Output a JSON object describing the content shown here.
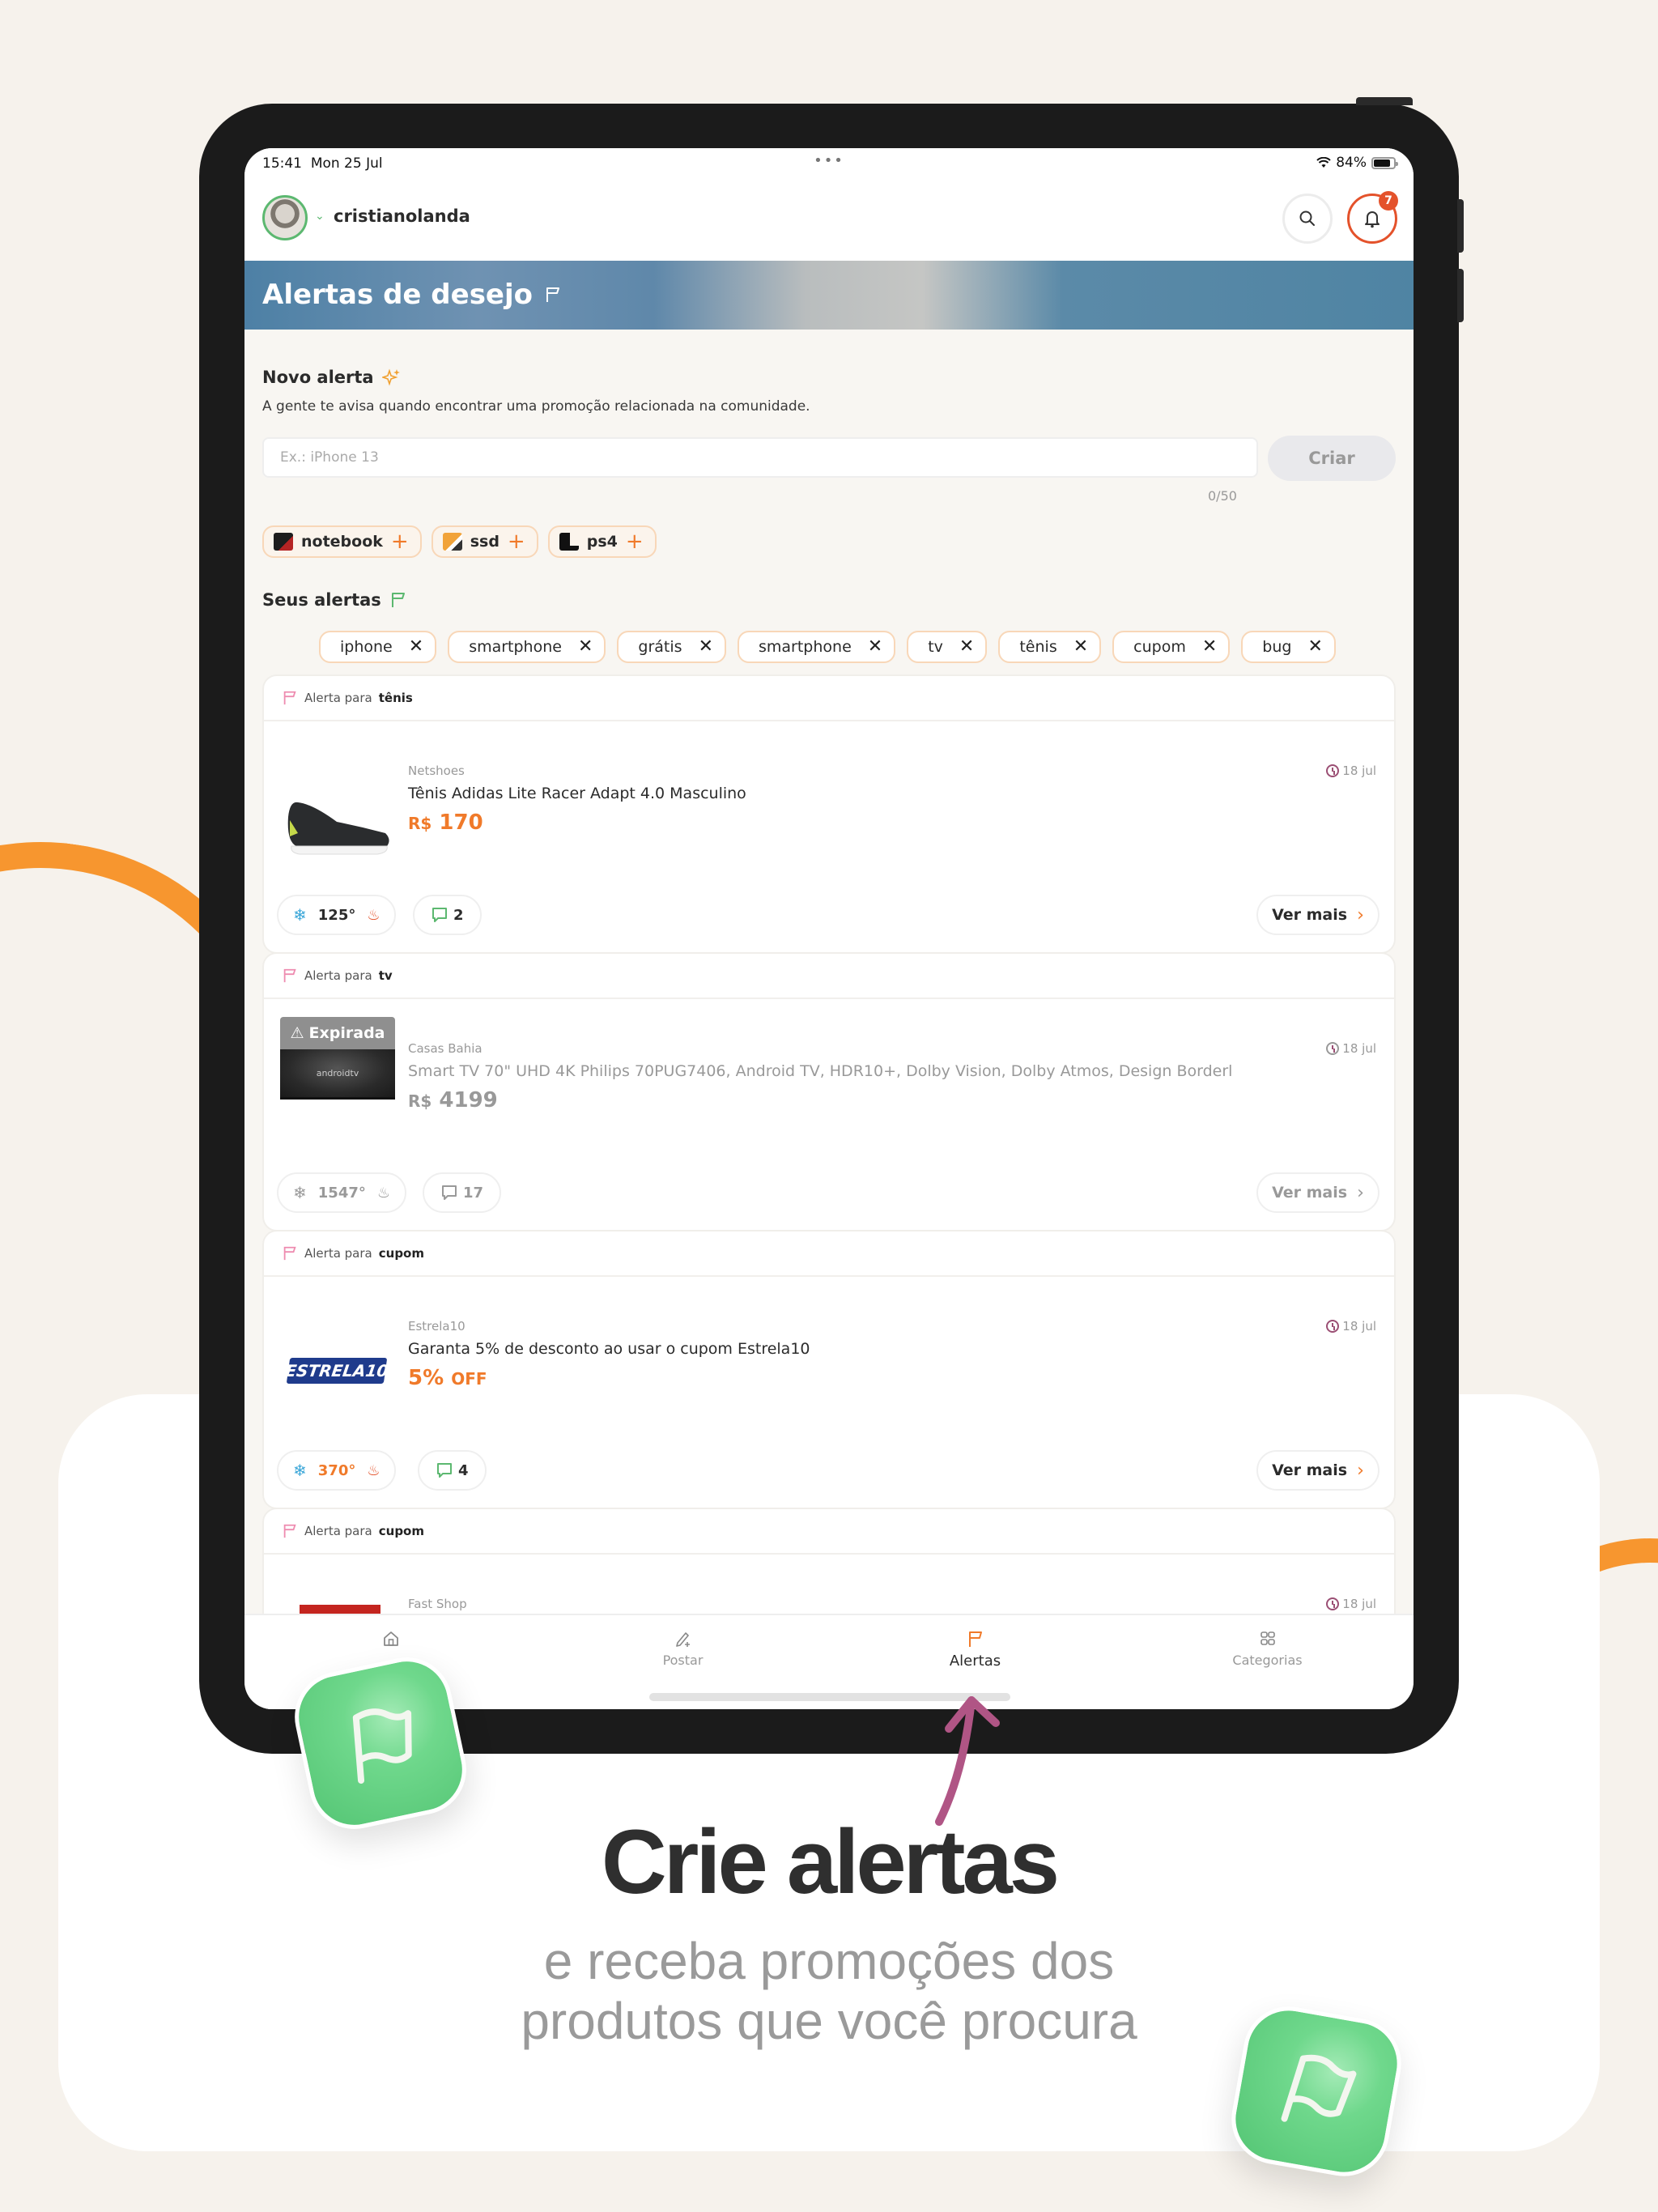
{
  "statusbar": {
    "time": "15:41",
    "date": "Mon 25 Jul",
    "battery_text": "84%",
    "battery_level": 0.84
  },
  "header": {
    "username": "cristianolanda",
    "notification_count": "7",
    "icons": {
      "search": "search-icon",
      "bell": "bell-icon"
    }
  },
  "banner": {
    "title": "Alertas de desejo"
  },
  "new_alert": {
    "title": "Novo alerta",
    "helper": "A gente te avisa quando encontrar uma promoção relacionada na comunidade.",
    "input_value": "",
    "input_placeholder": "Ex.: iPhone 13",
    "create_label": "Criar",
    "counter": "0/50",
    "suggestions": [
      {
        "label": "notebook"
      },
      {
        "label": "ssd"
      },
      {
        "label": "ps4"
      }
    ]
  },
  "my_alerts": {
    "title": "Seus alertas",
    "chips": [
      {
        "label": "iphone"
      },
      {
        "label": "smartphone"
      },
      {
        "label": "grátis"
      },
      {
        "label": "smartphone"
      },
      {
        "label": "tv"
      },
      {
        "label": "tênis"
      },
      {
        "label": "cupom"
      },
      {
        "label": "bug"
      }
    ]
  },
  "cards": [
    {
      "head_prefix": "Alerta para",
      "keyword": "tênis",
      "store": "Netshoes",
      "title": "Tênis Adidas Lite Racer Adapt 4.0 Masculino",
      "price_prefix": "R$",
      "price": "170",
      "date": "18 jul",
      "temperature": "125°",
      "comments": "2",
      "more_label": "Ver mais",
      "expired": false
    },
    {
      "head_prefix": "Alerta para",
      "keyword": "tv",
      "store": "Casas Bahia",
      "title": "Smart TV 70\" UHD 4K Philips 70PUG7406, Android TV, HDR10+, Dolby Vision, Dolby Atmos, Design Borderl",
      "price_prefix": "R$",
      "price": "4199",
      "date": "18 jul",
      "temperature": "1547°",
      "comments": "17",
      "more_label": "Ver mais",
      "expired": true,
      "expired_label": "Expirada",
      "image_text": "androidtv"
    },
    {
      "head_prefix": "Alerta para",
      "keyword": "cupom",
      "store": "Estrela10",
      "title": "Garanta 5% de desconto ao usar o cupom Estrela10",
      "price_prefix": "",
      "price": "5%",
      "price_suffix": "OFF",
      "date": "18 jul",
      "temperature": "370°",
      "comments": "4",
      "more_label": "Ver mais",
      "expired": false,
      "image_text": "ESTRELA10"
    },
    {
      "head_prefix": "Alerta para",
      "keyword": "cupom",
      "store": "Fast Shop",
      "date": "18 jul"
    }
  ],
  "tabbar": {
    "items": [
      {
        "label": "",
        "icon": "home-icon"
      },
      {
        "label": "Postar",
        "icon": "pencil-plus-icon"
      },
      {
        "label": "Alertas",
        "icon": "flag-icon",
        "active": true
      },
      {
        "label": "Categorias",
        "icon": "grid-icon"
      }
    ]
  },
  "marketing": {
    "headline": "Crie alertas",
    "subline_1": "e receba promoções dos",
    "subline_2": "produtos que você procura"
  },
  "colors": {
    "accent_orange": "#f07a2a",
    "notification_red": "#e4522b",
    "green": "#5cb870",
    "arrow_magenta": "#b05585",
    "background": "#f6f2ec"
  }
}
